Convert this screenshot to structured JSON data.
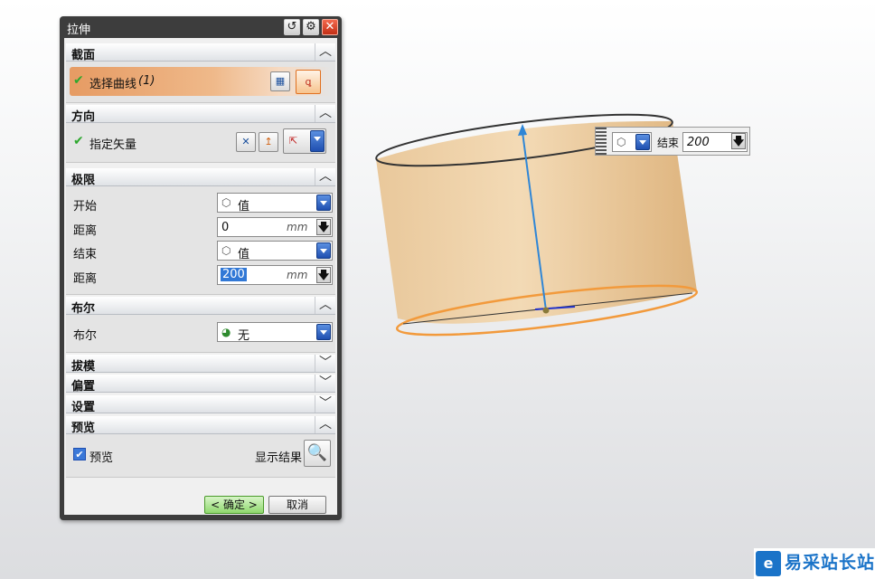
{
  "dialog": {
    "title": "拉伸",
    "sections": {
      "section": {
        "title": "截面",
        "select_curve_label": "选择曲线",
        "select_curve_count": "(1)"
      },
      "direction": {
        "title": "方向",
        "specify_vector_label": "指定矢量"
      },
      "limits": {
        "title": "极限",
        "start_label": "开始",
        "start_value": "值",
        "distance1_label": "距离",
        "distance1_value": "0",
        "distance1_unit": "mm",
        "end_label": "结束",
        "end_value": "值",
        "distance2_label": "距离",
        "distance2_value": "200",
        "distance2_unit": "mm"
      },
      "boolean": {
        "title": "布尔",
        "boolean_label": "布尔",
        "boolean_value": "无"
      },
      "draft": {
        "title": "拔模"
      },
      "offset": {
        "title": "偏置"
      },
      "settings": {
        "title": "设置"
      },
      "preview": {
        "title": "预览",
        "preview_checkbox_label": "预览",
        "preview_checked": true,
        "show_result_label": "显示结果"
      }
    },
    "ok_label": "< 确定 >",
    "cancel_label": "取消"
  },
  "viewport": {
    "floating_toolbar": {
      "end_label": "结束",
      "end_value": "200"
    },
    "body_color": "#e9c48f",
    "edge_highlight_color": "#f29a3c",
    "vector_color": "#2f86d6"
  },
  "watermark": {
    "text": "易采站长站"
  }
}
